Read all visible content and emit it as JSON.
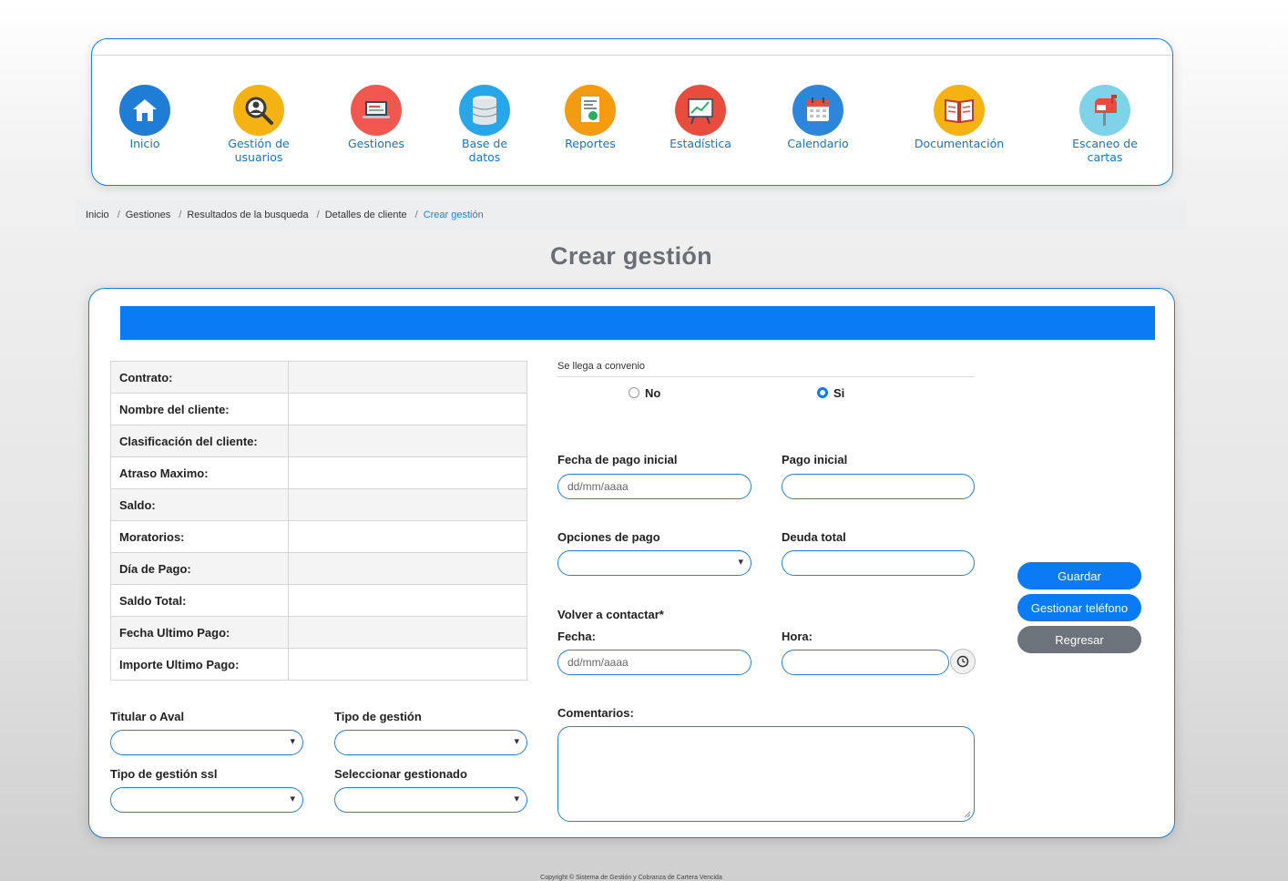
{
  "nav": {
    "items": [
      {
        "label": "Inicio",
        "icon": "home-icon",
        "color": "#1f7dd6"
      },
      {
        "label": "Gestión de\nusuarios",
        "icon": "user-search-icon",
        "color": "#f5b313"
      },
      {
        "label": "Gestiones",
        "icon": "laptop-icon",
        "color": "#f0584f"
      },
      {
        "label": "Base de\ndatos",
        "icon": "database-icon",
        "color": "#27a7e8"
      },
      {
        "label": "Reportes",
        "icon": "report-icon",
        "color": "#f39c12"
      },
      {
        "label": "Estadística",
        "icon": "chart-board-icon",
        "color": "#e74c3c"
      },
      {
        "label": "Calendario",
        "icon": "calendar-icon",
        "color": "#2d86d9"
      },
      {
        "label": "Documentación",
        "icon": "book-icon",
        "color": "#f5b313"
      },
      {
        "label": "Escaneo de\ncartas",
        "icon": "mailbox-icon",
        "color": "#7fd3e8"
      }
    ]
  },
  "breadcrumb": {
    "items": [
      "Inicio",
      "Gestiones",
      "Resultados de la busqueda",
      "Detalles de cliente"
    ],
    "active": "Crear gestión"
  },
  "page_title": "Crear gestión",
  "client_info": {
    "rows": [
      {
        "label": "Contrato:",
        "value": ""
      },
      {
        "label": "Nombre del cliente:",
        "value": ""
      },
      {
        "label": "Clasificación del cliente:",
        "value": ""
      },
      {
        "label": "Atraso Maximo:",
        "value": ""
      },
      {
        "label": "Saldo:",
        "value": ""
      },
      {
        "label": "Moratorios:",
        "value": ""
      },
      {
        "label": "Día de Pago:",
        "value": ""
      },
      {
        "label": "Saldo Total:",
        "value": ""
      },
      {
        "label": "Fecha Ultimo Pago:",
        "value": ""
      },
      {
        "label": "Importe Ultimo Pago:",
        "value": ""
      }
    ]
  },
  "selects": {
    "titular_label": "Titular o Aval",
    "tipo_gestion_label": "Tipo de gestión",
    "tipo_gestion_ssl_label": "Tipo de gestión ssl",
    "seleccionar_gestionado_label": "Seleccionar gestionado"
  },
  "convenio": {
    "label": "Se llega a convenio",
    "option_no": "No",
    "option_si": "Si",
    "selected": "Si"
  },
  "form": {
    "fecha_pago_inicial_label": "Fecha de pago inicial",
    "fecha_pago_inicial_placeholder": "dd/mm/aaaa",
    "pago_inicial_label": "Pago inicial",
    "opciones_pago_label": "Opciones de pago",
    "deuda_total_label": "Deuda total",
    "volver_contactar_label": "Volver a contactar*",
    "fecha_label": "Fecha:",
    "fecha_placeholder": "dd/mm/aaaa",
    "hora_label": "Hora:",
    "comentarios_label": "Comentarios:"
  },
  "buttons": {
    "guardar": "Guardar",
    "gestionar_telefono": "Gestionar teléfono",
    "regresar": "Regresar"
  },
  "footer": "Copyright © Sistema de Gestión y Cobranza de Cartera Vencida"
}
